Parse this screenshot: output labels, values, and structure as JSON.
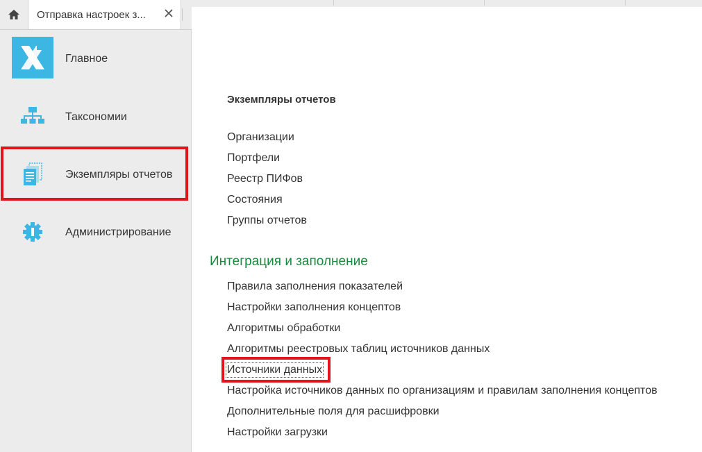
{
  "tabs": {
    "home_icon": "home-icon",
    "active_tab_label": "Отправка настроек з...",
    "close_icon": "close-icon"
  },
  "sidebar": {
    "items": [
      {
        "label": "Главное",
        "icon": "app-logo-icon"
      },
      {
        "label": "Таксономии",
        "icon": "hierarchy-icon"
      },
      {
        "label": "Экземпляры отчетов",
        "icon": "documents-icon"
      },
      {
        "label": "Администрирование",
        "icon": "gear-icon"
      }
    ],
    "selected_index": 2
  },
  "main": {
    "section_title": "Экземпляры отчетов",
    "section_links": [
      "Организации",
      "Портфели",
      "Реестр ПИФов",
      "Состояния",
      "Группы отчетов"
    ],
    "group_title": "Интеграция и заполнение",
    "group_links": [
      "Правила заполнения показателей",
      "Настройки заполнения концептов",
      "Алгоритмы обработки",
      "Алгоритмы реестровых таблиц источников данных",
      "Источники данных",
      "Настройка источников данных по организациям и правилам заполнения концептов",
      "Дополнительные поля для расшифровки",
      "Настройки загрузки"
    ]
  },
  "colors": {
    "accent_blue": "#3cb6e3",
    "group_title_green": "#1a8a3f",
    "highlight_red": "#e0141c",
    "sidebar_bg": "#ececec"
  }
}
